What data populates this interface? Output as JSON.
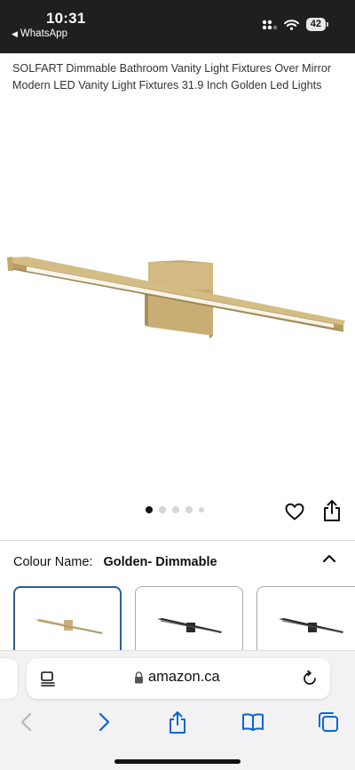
{
  "status_bar": {
    "time": "10:31",
    "back_app": "WhatsApp",
    "battery": "42",
    "icons": [
      "signal-icon",
      "wifi-icon",
      "battery-icon"
    ]
  },
  "product": {
    "title": "SOLFART Dimmable Bathroom Vanity Light Fixtures Over Mirror Modern LED Vanity Light Fixtures 31.9 Inch Golden Led Lights",
    "carousel": {
      "current": 1,
      "total": 5
    },
    "actions": [
      "heart-icon",
      "share-icon"
    ]
  },
  "variation": {
    "label": "Colour Name:",
    "selected_value": "Golden- Dimmable",
    "swatches": [
      {
        "name": "golden",
        "finish_color": "#c9b07a",
        "selected": true
      },
      {
        "name": "black",
        "finish_color": "#2b2b2b",
        "selected": false
      },
      {
        "name": "black-alt",
        "finish_color": "#2b2b2b",
        "selected": false
      }
    ]
  },
  "browser": {
    "url": "amazon.ca",
    "accent": "#0a64d6",
    "nav": [
      "back-icon",
      "forward-icon",
      "share-icon",
      "bookmarks-icon",
      "tabs-icon"
    ]
  },
  "colors": {
    "status_bg": "#1f1f1f",
    "brass": "#c9b07a",
    "selected_border": "#2b5f95"
  }
}
